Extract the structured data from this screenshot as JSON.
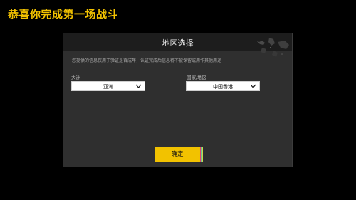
{
  "page": {
    "title": "恭喜你完成第一场战斗"
  },
  "dialog": {
    "title": "地区选择",
    "notice": "您提供的信息仅用于验证是否成年，认证完成后信息将不被保留或用作其他用途"
  },
  "continent": {
    "label": "大洲",
    "value": "亚洲"
  },
  "region": {
    "label": "国家/地区",
    "value": "中国香港"
  },
  "confirm": {
    "label": "确定"
  },
  "colors": {
    "accent": "#f2c200",
    "panel": "#2f2f2f",
    "header": "#1d1d1d"
  },
  "icons": {
    "dropdown": "chevron-down-icon",
    "header_decoration": "map-pattern-decoration"
  }
}
